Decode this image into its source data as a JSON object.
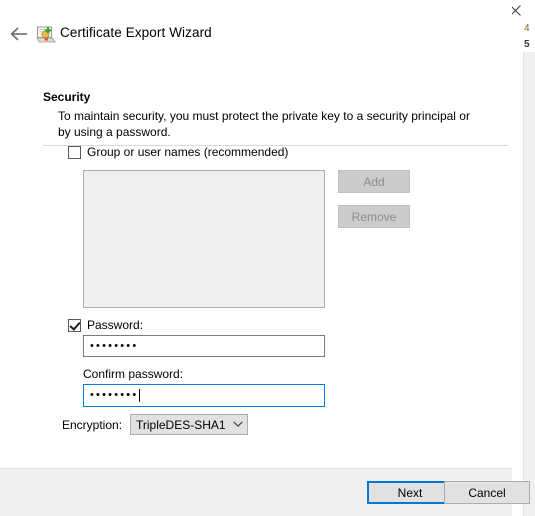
{
  "window": {
    "title": "Certificate Export Wizard",
    "back_icon": "back-arrow-icon",
    "app_icon": "certificate-export-icon",
    "close_icon": "close-icon"
  },
  "behind_window": {
    "glyph_top": "4",
    "glyph_bottom": "5"
  },
  "page": {
    "heading": "Security",
    "description": "To maintain security, you must protect the private key to a security principal or by using a password."
  },
  "group_names": {
    "label": "Group or user names (recommended)",
    "checked": false,
    "listbox_items": []
  },
  "side_buttons": {
    "add_label": "Add",
    "remove_label": "Remove",
    "add_enabled": false,
    "remove_enabled": false
  },
  "password_section": {
    "checkbox_label": "Password:",
    "checked": true,
    "password_value": "••••••••",
    "confirm_label": "Confirm password:",
    "confirm_value": "••••••••"
  },
  "encryption": {
    "label": "Encryption:",
    "selected": "TripleDES-SHA1",
    "chevron_icon": "chevron-down-icon"
  },
  "footer": {
    "next_label": "Next",
    "cancel_label": "Cancel"
  },
  "colors": {
    "accent": "#0078d7",
    "footer_bg": "#f0f0f0",
    "disabled_text": "#8d8d8d"
  }
}
